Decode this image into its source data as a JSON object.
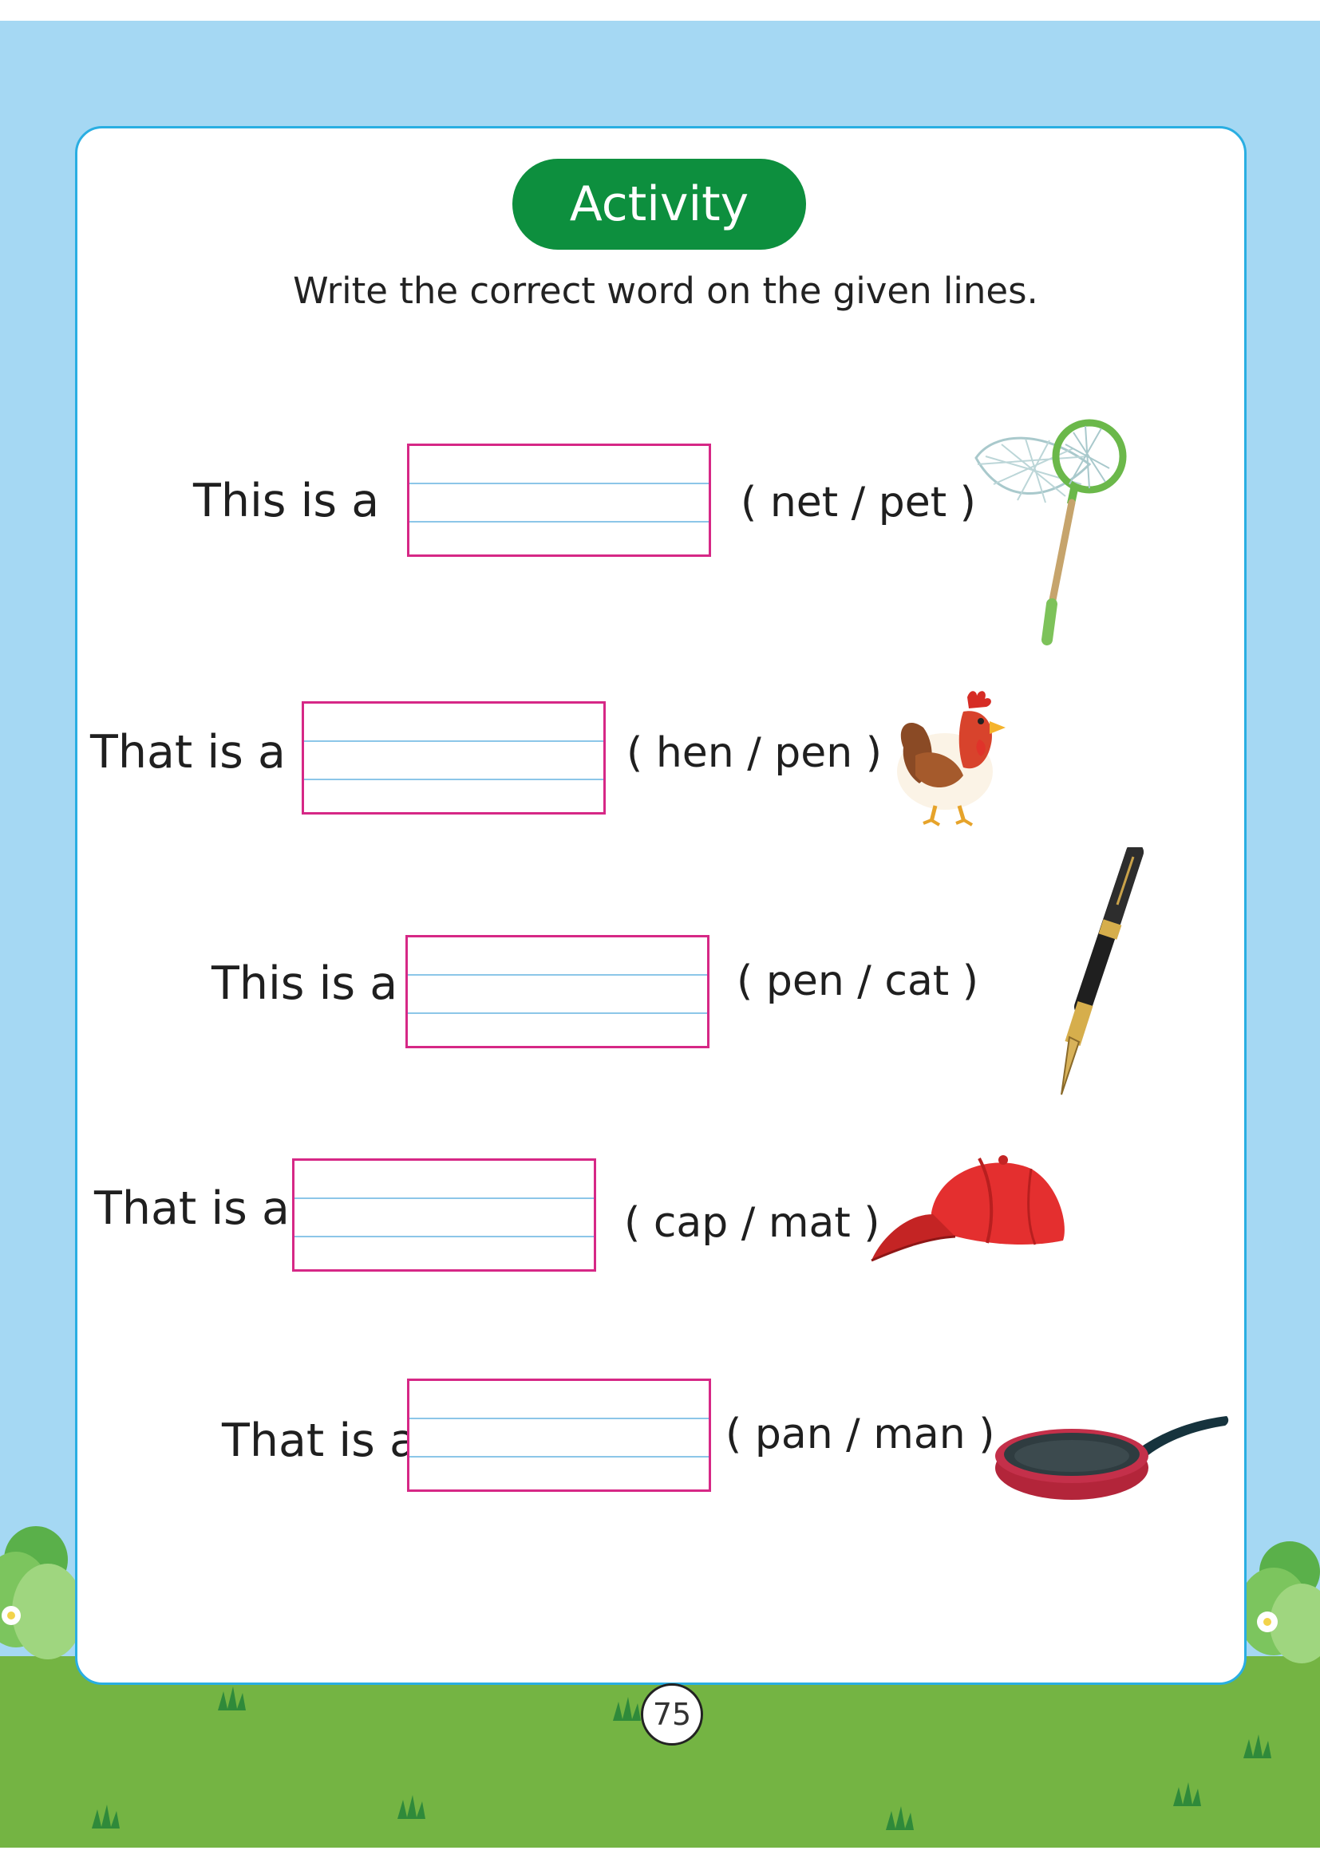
{
  "activity": {
    "title": "Activity",
    "instruction": "Write the correct word on the given lines."
  },
  "rows": [
    {
      "phrase": "This is a",
      "choices": "( net / pet )",
      "picture": "butterfly-net",
      "answer": ""
    },
    {
      "phrase": "That is a",
      "choices": "( hen / pen )",
      "picture": "hen",
      "answer": ""
    },
    {
      "phrase": "This is a",
      "choices": "( pen / cat )",
      "picture": "fountain-pen",
      "answer": ""
    },
    {
      "phrase": "That is a",
      "choices": "( cap / mat )",
      "picture": "red-cap",
      "answer": ""
    },
    {
      "phrase": "That is a",
      "choices": "( pan / man )",
      "picture": "frying-pan",
      "answer": ""
    }
  ],
  "page_number": "75",
  "colors": {
    "sky": "#a5d8f3",
    "grass": "#74b443",
    "card_border": "#29aee2",
    "pill": "#0d8f3e",
    "answer_box_border": "#d62886",
    "writing_lines": "#8cc6e8"
  }
}
